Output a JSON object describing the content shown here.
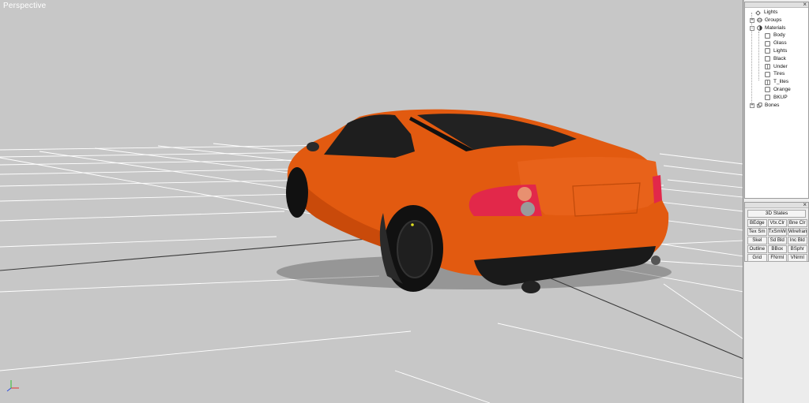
{
  "viewport": {
    "label": "Perspective",
    "background": "#c7c7c7",
    "grid_color": "#ffffff",
    "axis_line_color": "#333333",
    "model_color": "#e25a10",
    "axis_gizmo": {
      "x_color": "#e03030",
      "y_color": "#30c030",
      "z_color": "#3050e0"
    }
  },
  "scene_tree": {
    "items": [
      {
        "label": "Lights",
        "icon": "light-icon",
        "level": 0,
        "expander": ""
      },
      {
        "label": "Groups",
        "icon": "groups-icon",
        "level": 0,
        "expander": "+"
      },
      {
        "label": "Materials",
        "icon": "materials-icon",
        "level": 0,
        "expander": "-"
      },
      {
        "label": "Body",
        "icon": "material-icon",
        "level": 1
      },
      {
        "label": "Glass",
        "icon": "material-icon",
        "level": 1
      },
      {
        "label": "Lights",
        "icon": "material-icon",
        "level": 1
      },
      {
        "label": "Black",
        "icon": "material-icon",
        "level": 1
      },
      {
        "label": "Under",
        "icon": "material-icon",
        "level": 1
      },
      {
        "label": "Tires",
        "icon": "material-icon",
        "level": 1
      },
      {
        "label": "T_lites",
        "icon": "material-icon",
        "level": 1
      },
      {
        "label": "Orange",
        "icon": "material-icon",
        "level": 1
      },
      {
        "label": "BKUP",
        "icon": "material-icon",
        "level": 1
      },
      {
        "label": "Bones",
        "icon": "bones-icon",
        "level": 0,
        "expander": "+"
      }
    ]
  },
  "states_panel": {
    "title": "3D States",
    "close": "×",
    "buttons": [
      "BEdge",
      "Vtx.Clr",
      "Bne Clr",
      "Tex Sm",
      "TxSmWr",
      "Wireframe",
      "Skel",
      "Sd Bld",
      "Inc Bld",
      "Outline",
      "BBox",
      "BSphr",
      "Grid",
      "FNrml",
      "VNrml"
    ]
  },
  "tree_panel": {
    "close": "×"
  }
}
